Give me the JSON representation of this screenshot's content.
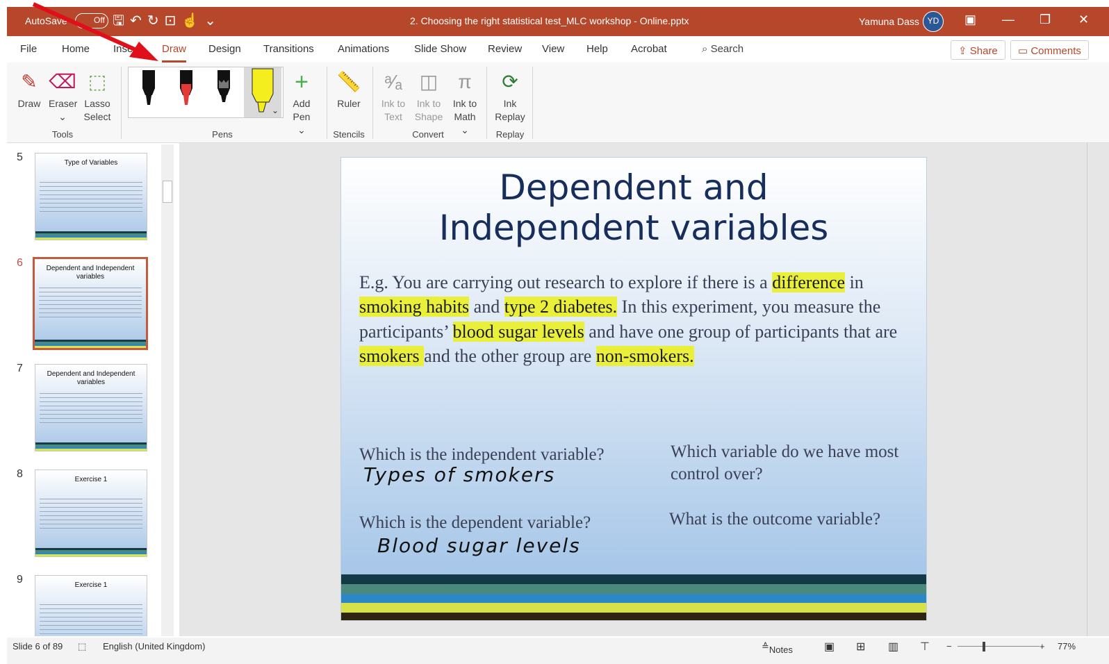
{
  "titlebar": {
    "autosave": "AutoSave",
    "toggle": "Off",
    "doc_title": "2. Choosing the right statistical test_MLC workshop - Online.pptx",
    "user": "Yamuna Dass",
    "initials": "YD"
  },
  "tabs": [
    "File",
    "Home",
    "Inse",
    "Draw",
    "Design",
    "Transitions",
    "Animations",
    "Slide Show",
    "Review",
    "View",
    "Help",
    "Acrobat"
  ],
  "search": "Search",
  "share": "Share",
  "comments": "Comments",
  "ribbon": {
    "tools": {
      "draw": "Draw",
      "eraser": "Eraser",
      "lasso1": "Lasso",
      "lasso2": "Select",
      "group": "Tools"
    },
    "pens": {
      "add1": "Add",
      "add2": "Pen ⌄",
      "group": "Pens"
    },
    "stencils": {
      "ruler": "Ruler",
      "group": "Stencils"
    },
    "convert": {
      "text1": "Ink to",
      "text2": "Text",
      "shape1": "Ink to",
      "shape2": "Shape",
      "math1": "Ink to",
      "math2": "Math ⌄",
      "group": "Convert"
    },
    "replay": {
      "l1": "Ink",
      "l2": "Replay",
      "group": "Replay"
    }
  },
  "thumbs": [
    {
      "num": "5",
      "title": "Type of Variables"
    },
    {
      "num": "6",
      "title": "Dependent and Independent variables"
    },
    {
      "num": "7",
      "title": "Dependent and Independent variables"
    },
    {
      "num": "8",
      "title": "Exercise 1"
    },
    {
      "num": "9",
      "title": "Exercise 1"
    }
  ],
  "slide": {
    "title1": "Dependent and",
    "title2": "Independent variables",
    "b1": "E.g. You are carrying out research to explore if there is a ",
    "h1": "difference",
    "b2": " in ",
    "h2": "smoking habits",
    "b3": " and ",
    "h3": "type 2 diabetes.",
    "b4": " In this experiment, you measure the participants’ ",
    "h4": "blood sugar levels",
    "b5": " and have one group of participants that are ",
    "h5": "smokers ",
    "b6": "and the other group are ",
    "h6": "non-smokers.",
    "q1": "Which is the independent variable?",
    "ink1": "Types of smokers",
    "q2": "Which variable do we have most control over?",
    "q3": "Which is the dependent variable?",
    "ink2": "Blood sugar levels",
    "q4": "What is the outcome variable?"
  },
  "status": {
    "slide": "Slide 6 of 89",
    "lang": "English (United Kingdom)",
    "notes": "Notes",
    "zoom": "77%"
  },
  "colors": {
    "accent": "#b7472a",
    "highlight": "#eaf03a",
    "slide_title": "#172d5c"
  }
}
